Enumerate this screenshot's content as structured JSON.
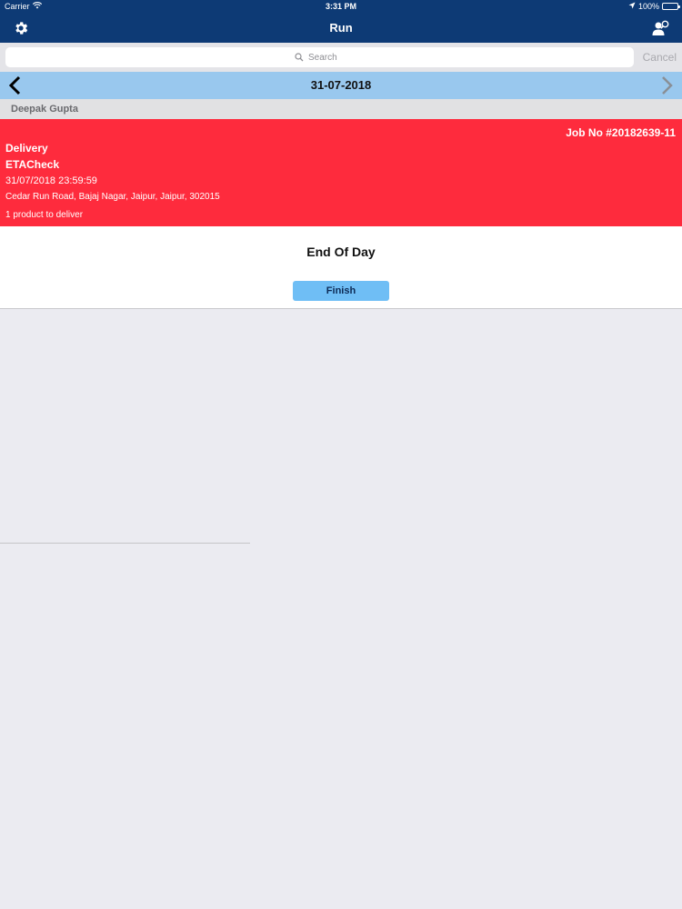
{
  "status_bar": {
    "carrier": "Carrier",
    "time": "3:31 PM",
    "battery": "100%"
  },
  "nav": {
    "title": "Run",
    "left_icon": "gear-icon",
    "right_icon": "user-search-icon"
  },
  "search": {
    "placeholder": "Search",
    "cancel_label": "Cancel"
  },
  "date_bar": {
    "date": "31-07-2018"
  },
  "driver": {
    "name": "Deepak Gupta"
  },
  "job": {
    "number": "Job No #20182639-11",
    "type": "Delivery",
    "eta": "ETACheck",
    "datetime": "31/07/2018 23:59:59",
    "address": "Cedar Run Road, Bajaj Nagar, Jaipur, Jaipur, 302015",
    "products": "1 product to deliver",
    "color": "#fe2b3d"
  },
  "end_of_day": {
    "title": "End Of Day",
    "finish_label": "Finish"
  },
  "colors": {
    "nav_bg": "#0d3a75",
    "date_bar_bg": "#99c8ee",
    "finish_bg": "#6fbef5"
  }
}
